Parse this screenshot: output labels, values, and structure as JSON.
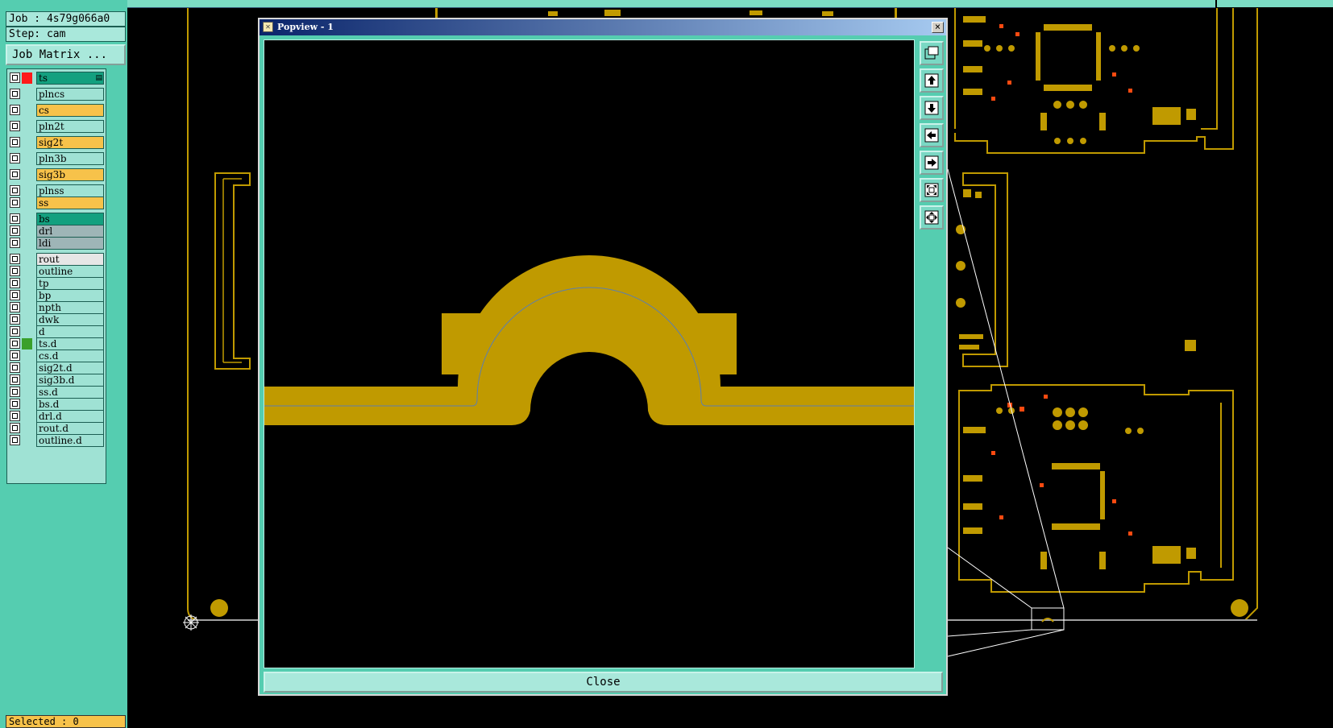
{
  "job_box": {
    "text": "Job : 4s79g066a0"
  },
  "step_box": {
    "text": "Step: cam"
  },
  "job_matrix_button": {
    "label": "Job Matrix ..."
  },
  "layers": [
    {
      "name": "ts",
      "bg": "#13a07f",
      "mark": "#ff1a1a",
      "active": true
    },
    {
      "name": "plncs",
      "bg": "#9fe2d4"
    },
    {
      "name": "cs",
      "bg": "#f7c24a"
    },
    {
      "name": "pln2t",
      "bg": "#9fe2d4"
    },
    {
      "name": "sig2t",
      "bg": "#f7c24a"
    },
    {
      "name": "pln3b",
      "bg": "#9fe2d4"
    },
    {
      "name": "sig3b",
      "bg": "#f7c24a"
    },
    {
      "name": "plnss",
      "bg": "#9fe2d4"
    },
    {
      "name": "ss",
      "bg": "#f7c24a"
    },
    {
      "name": "bs",
      "bg": "#13a07f"
    },
    {
      "name": "drl",
      "bg": "#9eb5b7"
    },
    {
      "name": "ldi",
      "bg": "#9eb5b7"
    },
    {
      "name": "rout",
      "bg": "#e6e6e6"
    },
    {
      "name": "outline",
      "bg": "#9fe2d4"
    },
    {
      "name": "tp",
      "bg": "#9fe2d4"
    },
    {
      "name": "bp",
      "bg": "#9fe2d4"
    },
    {
      "name": "npth",
      "bg": "#9fe2d4"
    },
    {
      "name": "dwk",
      "bg": "#9fe2d4"
    },
    {
      "name": "d",
      "bg": "#9fe2d4"
    },
    {
      "name": "ts.d",
      "bg": "#9fe2d4",
      "mark": "#3aa02a"
    },
    {
      "name": "cs.d",
      "bg": "#9fe2d4"
    },
    {
      "name": "sig2t.d",
      "bg": "#9fe2d4"
    },
    {
      "name": "sig3b.d",
      "bg": "#9fe2d4"
    },
    {
      "name": "ss.d",
      "bg": "#9fe2d4"
    },
    {
      "name": "bs.d",
      "bg": "#9fe2d4"
    },
    {
      "name": "drl.d",
      "bg": "#9fe2d4"
    },
    {
      "name": "rout.d",
      "bg": "#9fe2d4"
    },
    {
      "name": "outline.d",
      "bg": "#9fe2d4"
    }
  ],
  "selected_box": {
    "text": "Selected : 0"
  },
  "popup": {
    "title": "Popview - 1",
    "close_x": "×",
    "close_label": "Close",
    "title_icon": "✕"
  },
  "toolbar_icons": [
    "window-icon",
    "pan-up-icon",
    "pan-down-icon",
    "pan-left-icon",
    "pan-right-icon",
    "zoom-fit-icon",
    "zoom-home-icon"
  ],
  "colors": {
    "copper": "#c09a00",
    "panel": "#55cdb0",
    "pad": "#ff4a10"
  }
}
